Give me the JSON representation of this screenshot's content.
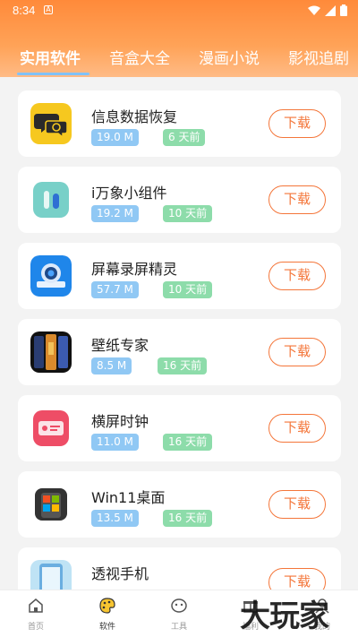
{
  "statusbar": {
    "time": "8:34",
    "notif_letter": "A"
  },
  "tabs": [
    {
      "label": "实用软件"
    },
    {
      "label": "音盒大全"
    },
    {
      "label": "漫画小说"
    },
    {
      "label": "影视追剧"
    }
  ],
  "apps": [
    {
      "name": "信息数据恢复",
      "size": "19.0 M",
      "date": "6 天前",
      "button": "下载",
      "icon": "message-recovery-icon"
    },
    {
      "name": "i万象小组件",
      "size": "19.2 M",
      "date": "10 天前",
      "button": "下载",
      "icon": "widget-icon"
    },
    {
      "name": "屏幕录屏精灵",
      "size": "57.7 M",
      "date": "10 天前",
      "button": "下载",
      "icon": "screen-recorder-icon"
    },
    {
      "name": "壁纸专家",
      "size": "8.5 M",
      "date": "16 天前",
      "button": "下载",
      "icon": "wallpaper-icon"
    },
    {
      "name": "横屏时钟",
      "size": "11.0 M",
      "date": "16 天前",
      "button": "下载",
      "icon": "clock-icon"
    },
    {
      "name": "Win11桌面",
      "size": "13.5 M",
      "date": "16 天前",
      "button": "下载",
      "icon": "win11-desktop-icon"
    },
    {
      "name": "透视手机",
      "size": "",
      "date": "",
      "button": "下载",
      "icon": "transparent-phone-icon"
    }
  ],
  "bottom_nav": [
    {
      "label": "首页",
      "icon": "home-icon"
    },
    {
      "label": "软件",
      "icon": "palette-icon"
    },
    {
      "label": "工具",
      "icon": "tools-icon"
    },
    {
      "label": "福利",
      "icon": "gift-icon"
    },
    {
      "label": "我的",
      "icon": "user-icon"
    }
  ],
  "watermark": "大玩家",
  "colors": {
    "accent": "#f4763a",
    "header": "#ff8a3a",
    "size_badge": "#90c8f4",
    "date_badge": "#8ddcaa"
  }
}
